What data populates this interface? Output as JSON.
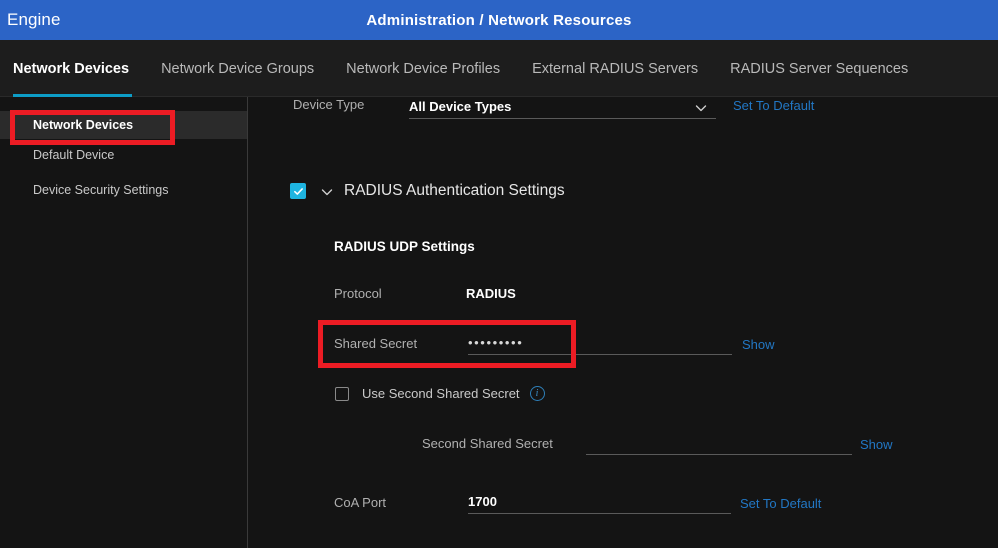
{
  "header": {
    "brand": "Engine",
    "title": "Administration / Network Resources",
    "bar_color": "#2c64c6"
  },
  "tabs": {
    "active_underline_color": "#0d9dc7",
    "items": [
      {
        "label": "Network Devices",
        "active": true
      },
      {
        "label": "Network Device Groups",
        "active": false
      },
      {
        "label": "Network Device Profiles",
        "active": false
      },
      {
        "label": "External RADIUS Servers",
        "active": false
      },
      {
        "label": "RADIUS Server Sequences",
        "active": false
      }
    ]
  },
  "sidebar": {
    "items": [
      {
        "label": "Network Devices",
        "selected": true
      },
      {
        "label": "Default Device",
        "selected": false
      },
      {
        "label": "Device Security Settings",
        "selected": false
      }
    ]
  },
  "form": {
    "device_type": {
      "label": "Device Type",
      "value": "All Device Types",
      "chevron": "chevron-down-icon",
      "action": "Set To Default"
    },
    "radius_auth": {
      "checkbox_checked": true,
      "checkbox_color": "#1eb4e0",
      "collapse_chevron": "chevron-down-icon",
      "title": "RADIUS Authentication Settings",
      "subsection_title": "RADIUS UDP Settings"
    },
    "protocol": {
      "label": "Protocol",
      "value": "RADIUS"
    },
    "shared_secret": {
      "label": "Shared Secret",
      "value": "•••••••••",
      "placeholder": "",
      "action": "Show"
    },
    "use_second_shared_secret": {
      "label": "Use Second Shared Secret",
      "checked": false,
      "info_icon": "info-icon"
    },
    "second_shared_secret": {
      "label": "Second Shared Secret",
      "value": "",
      "placeholder": "",
      "action": "Show"
    },
    "coa_port": {
      "label": "CoA Port",
      "value": "1700",
      "action": "Set To Default"
    }
  },
  "annotations": {
    "color": "#ec1c24",
    "boxes": [
      {
        "name": "sidebar-network-devices-highlight"
      },
      {
        "name": "shared-secret-highlight"
      }
    ]
  }
}
